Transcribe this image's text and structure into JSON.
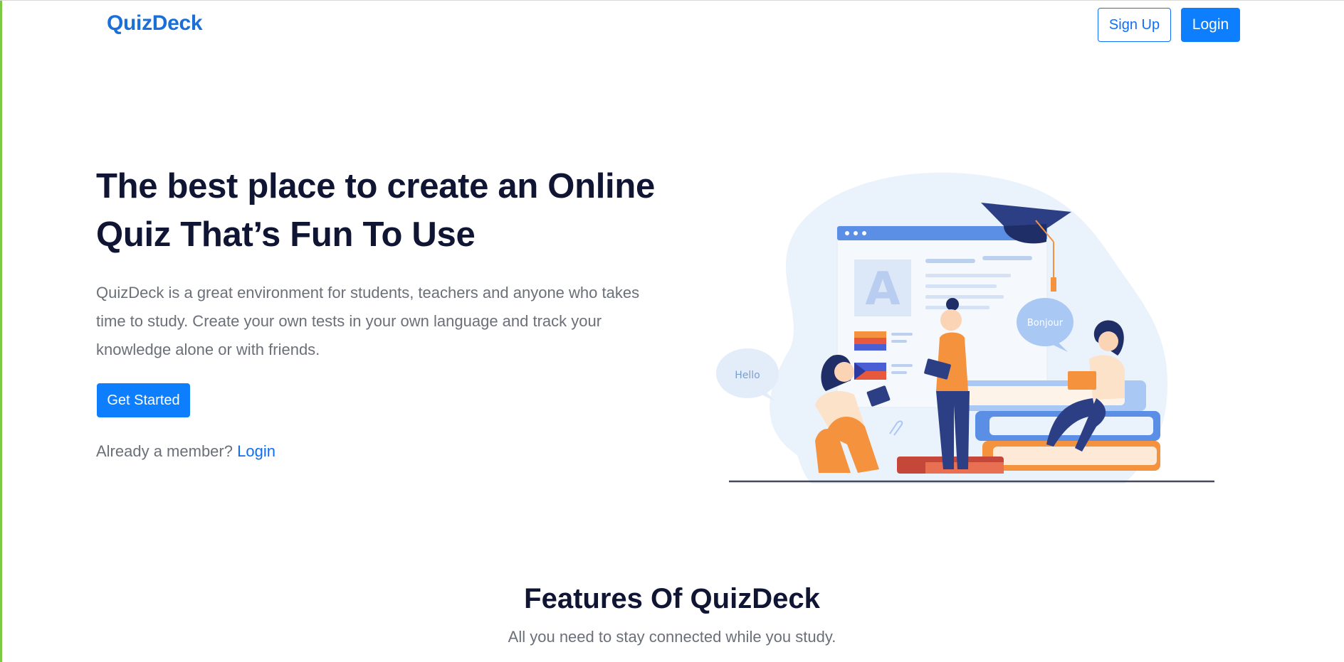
{
  "header": {
    "brand": "QuizDeck",
    "signup_label": "Sign Up",
    "login_label": "Login"
  },
  "hero": {
    "title": "The best place to create an Online Quiz That’s Fun To Use",
    "description": "QuizDeck is a great environment for students, teachers and anyone who takes time to study. Create your own tests in your own language and track your knowledge alone or with friends.",
    "cta_label": "Get Started",
    "member_prompt": "Already a member?",
    "member_login_link": "Login"
  },
  "illustration": {
    "speech_hello": "Hello",
    "speech_bonjour": "Bonjour",
    "card_letter": "A"
  },
  "features": {
    "title": "Features Of QuizDeck",
    "subtitle": "All you need to stay connected while you study."
  },
  "colors": {
    "accent": "#0d6efd",
    "brand": "#1a6fd8",
    "heading": "#0f1533",
    "muted": "#6b6f78",
    "left_edge": "#7ac943"
  }
}
